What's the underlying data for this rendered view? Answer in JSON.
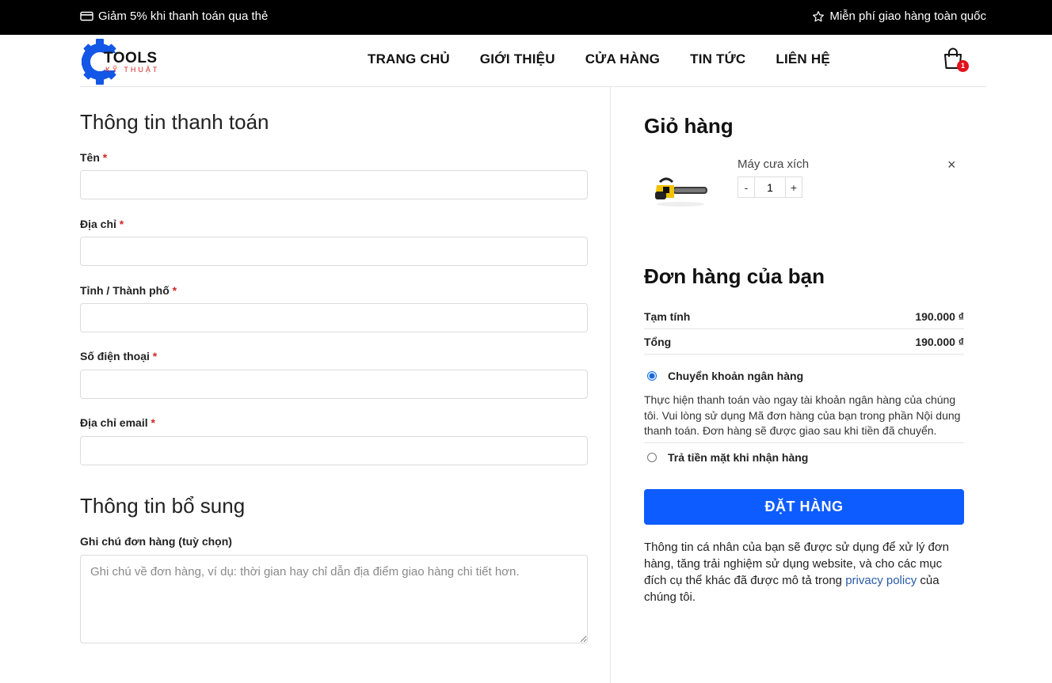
{
  "topbar": {
    "promo_left": "Giảm 5% khi thanh toán qua thẻ",
    "promo_right": "Miễn phí giao hàng toàn quốc"
  },
  "header": {
    "logo_main": "TOOLS",
    "logo_sub": "KỸ THUẬT",
    "nav": [
      "TRANG CHỦ",
      "GIỚI THIỆU",
      "CỬA HÀNG",
      "TIN TỨC",
      "LIÊN HỆ"
    ],
    "cart_count": "1",
    "accent_color": "#0d5cff"
  },
  "billing": {
    "title": "Thông tin thanh toán",
    "required_mark": "*",
    "fields": [
      {
        "label": "Tên",
        "value": ""
      },
      {
        "label": "Địa chỉ",
        "value": ""
      },
      {
        "label": "Tỉnh / Thành phố",
        "value": ""
      },
      {
        "label": "Số điện thoại",
        "value": ""
      },
      {
        "label": "Địa chỉ email",
        "value": ""
      }
    ]
  },
  "additional": {
    "title": "Thông tin bổ sung",
    "notes_label": "Ghi chú đơn hàng (tuỳ chọn)",
    "notes_placeholder": "Ghi chú về đơn hàng, ví dụ: thời gian hay chỉ dẫn địa điểm giao hàng chi tiết hơn."
  },
  "cart": {
    "title": "Giỏ hàng",
    "item": {
      "name": "Máy cưa xích",
      "quantity": "1",
      "minus": "-",
      "plus": "+",
      "remove": "×"
    }
  },
  "order": {
    "title": "Đơn hàng của bạn",
    "subtotal_label": "Tạm tính",
    "subtotal_value": "190.000 ₫",
    "total_label": "Tổng",
    "total_value": "190.000 ₫",
    "payment_bank": "Chuyển khoản ngân hàng",
    "payment_bank_desc": "Thực hiện thanh toán vào ngay tài khoản ngân hàng của chúng tôi. Vui lòng sử dụng Mã đơn hàng của bạn trong phần Nội dung thanh toán. Đơn hàng sẽ được giao sau khi tiền đã chuyển.",
    "payment_cod": "Trả tiền mặt khi nhận hàng",
    "place_order": "ĐẶT HÀNG",
    "privacy_before": "Thông tin cá nhân của bạn sẽ được sử dụng để xử lý đơn hàng, tăng trải nghiệm sử dụng website, và cho các mục đích cụ thể khác đã được mô tả trong ",
    "privacy_link": "privacy policy",
    "privacy_after": " của chúng tôi."
  }
}
